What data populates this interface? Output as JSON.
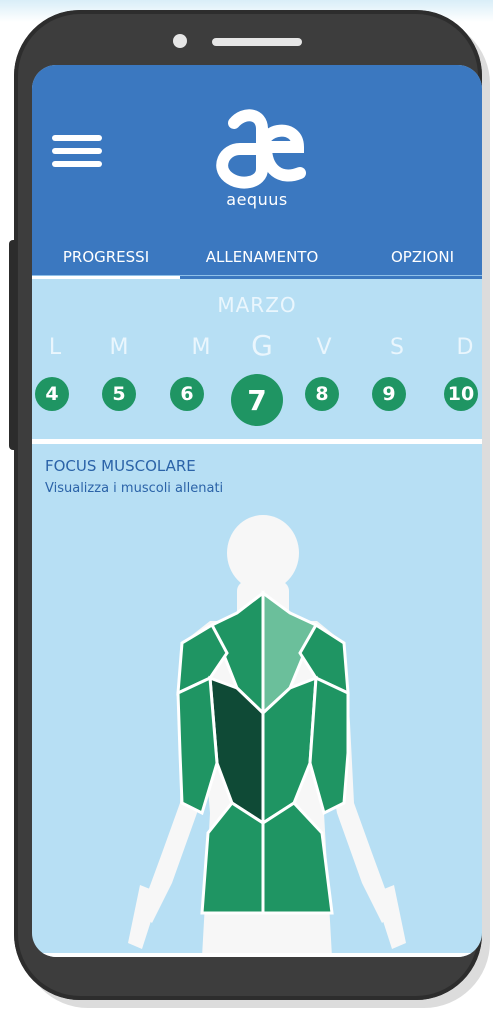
{
  "app": {
    "name": "aequus"
  },
  "tabs": [
    {
      "label": "PROGRESSI",
      "active": true
    },
    {
      "label": "ALLENAMENTO",
      "active": false
    },
    {
      "label": "OPZIONI",
      "active": false
    }
  ],
  "calendar": {
    "month": "MARZO",
    "days": [
      {
        "letter": "L",
        "number": "4"
      },
      {
        "letter": "M",
        "number": "5"
      },
      {
        "letter": "M",
        "number": "6"
      },
      {
        "letter": "G",
        "number": "7",
        "selected": true
      },
      {
        "letter": "V",
        "number": "8"
      },
      {
        "letter": "S",
        "number": "9"
      },
      {
        "letter": "D",
        "number": "10"
      }
    ]
  },
  "focus": {
    "title": "FOCUS MUSCOLARE",
    "subtitle": "Visualizza i muscoli allenati"
  },
  "colors": {
    "header": "#3b78c0",
    "screen": "#b7dff4",
    "accent": "#1f9563",
    "muscle_dark": "#0f4a36",
    "muscle_light": "#6bbf9b"
  }
}
